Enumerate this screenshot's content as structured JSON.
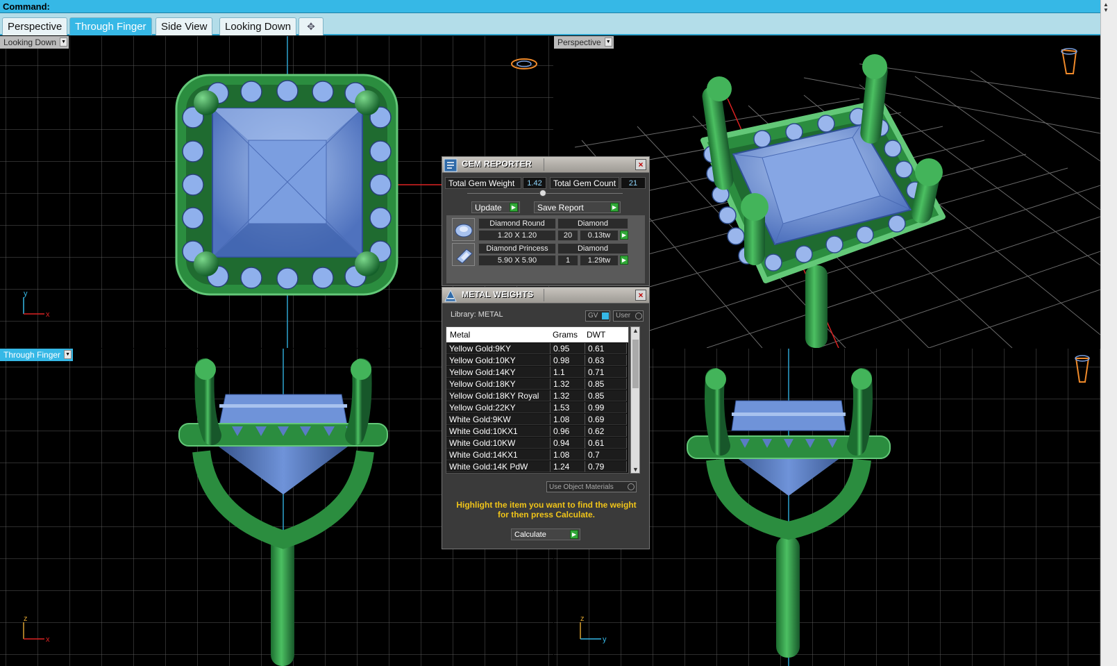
{
  "command_bar": {
    "label": "Command:"
  },
  "tabs": [
    {
      "label": "Perspective",
      "active": false
    },
    {
      "label": "Through Finger",
      "active": true
    },
    {
      "label": "Side View",
      "active": false
    },
    {
      "label": "Looking Down",
      "active": false
    },
    {
      "label": "✥",
      "icon": "add-tab-icon"
    }
  ],
  "viewports": {
    "top_left": {
      "label": "Looking Down",
      "axis_a": "y",
      "axis_b": "x"
    },
    "top_right": {
      "label": "Perspective"
    },
    "bottom_left": {
      "label": "Through Finger",
      "axis_a": "z",
      "axis_b": "x"
    },
    "bottom_right": {
      "label": "",
      "axis_a": "z",
      "axis_b": "y"
    }
  },
  "gem_reporter": {
    "title": "GEM REPORTER",
    "total_weight_label": "Total Gem Weight",
    "total_weight_value": "1.42",
    "total_count_label": "Total Gem Count",
    "total_count_value": "21",
    "update_label": "Update",
    "save_label": "Save Report",
    "gems": [
      {
        "name": "Diamond Round",
        "material": "Diamond",
        "size": "1.20 X 1.20",
        "count": "20",
        "weight": "0.13tw",
        "icon": "round-gem-icon"
      },
      {
        "name": "Diamond Princess",
        "material": "Diamond",
        "size": "5.90 X 5.90",
        "count": "1",
        "weight": "1.29tw",
        "icon": "princess-gem-icon"
      }
    ]
  },
  "metal_weights": {
    "title": "METAL WEIGHTS",
    "library_label": "Library: METAL",
    "gv_label": "GV",
    "user_label": "User",
    "columns": [
      "Metal",
      "Grams",
      "DWT"
    ],
    "rows": [
      {
        "metal": "Yellow Gold:9KY",
        "grams": "0.95",
        "dwt": "0.61"
      },
      {
        "metal": "Yellow Gold:10KY",
        "grams": "0.98",
        "dwt": "0.63"
      },
      {
        "metal": "Yellow Gold:14KY",
        "grams": "1.1",
        "dwt": "0.71"
      },
      {
        "metal": "Yellow Gold:18KY",
        "grams": "1.32",
        "dwt": "0.85"
      },
      {
        "metal": "Yellow Gold:18KY Royal",
        "grams": "1.32",
        "dwt": "0.85"
      },
      {
        "metal": "Yellow Gold:22KY",
        "grams": "1.53",
        "dwt": "0.99"
      },
      {
        "metal": "White Gold:9KW",
        "grams": "1.08",
        "dwt": "0.69"
      },
      {
        "metal": "White Gold:10KX1",
        "grams": "0.96",
        "dwt": "0.62"
      },
      {
        "metal": "White Gold:10KW",
        "grams": "0.94",
        "dwt": "0.61"
      },
      {
        "metal": "White Gold:14KX1",
        "grams": "1.08",
        "dwt": "0.7"
      },
      {
        "metal": "White Gold:14K PdW",
        "grams": "1.24",
        "dwt": "0.79"
      }
    ],
    "use_object_materials_label": "Use Object Materials",
    "hint": "Highlight the item you want to find the weight for then press Calculate.",
    "calculate_label": "Calculate"
  },
  "colors": {
    "accent": "#36b8e6",
    "metal_green": "#2e9a45",
    "gem_blue": "#6f93d9",
    "grid": "#5a5a5a",
    "hint_yellow": "#f0c419"
  }
}
